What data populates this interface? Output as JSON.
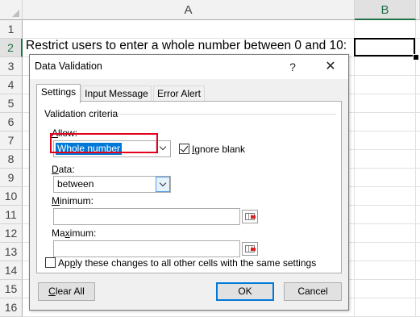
{
  "sheet": {
    "columns": [
      "A",
      "B",
      ""
    ],
    "rows": [
      "1",
      "2",
      "3",
      "4",
      "5",
      "6",
      "7",
      "8",
      "9",
      "10",
      "11",
      "12",
      "13",
      "14",
      "15",
      "16"
    ],
    "cell_a2": "Restrict users to enter a whole number between 0 and 10:"
  },
  "dialog": {
    "title": "Data Validation",
    "help": "?",
    "close": "✕",
    "tabs": [
      "Settings",
      "Input Message",
      "Error Alert"
    ],
    "legend": "Validation criteria",
    "allow_label_u": "A",
    "allow_label_rest": "llow:",
    "allow_value": "Whole number",
    "ignore_blank_u": "I",
    "ignore_blank_rest": "gnore blank",
    "ignore_blank_checked": true,
    "data_label_u": "D",
    "data_label_rest": "ata:",
    "data_value": "between",
    "minimum_label_u": "M",
    "minimum_label_rest": "inimum:",
    "minimum_value": "",
    "maximum_label_pre": "Ma",
    "maximum_label_u": "x",
    "maximum_label_rest": "imum:",
    "maximum_value": "",
    "apply_label_pre": "Ap",
    "apply_label_u": "p",
    "apply_label_rest": "ly these changes to all other cells with the same settings",
    "apply_checked": false,
    "clear_all_u": "C",
    "clear_all_rest": "lear All",
    "ok": "OK",
    "cancel": "Cancel"
  },
  "colors": {
    "highlight": "#0078d7",
    "annotation_box": "#e2001a",
    "excel_green": "#217346"
  }
}
